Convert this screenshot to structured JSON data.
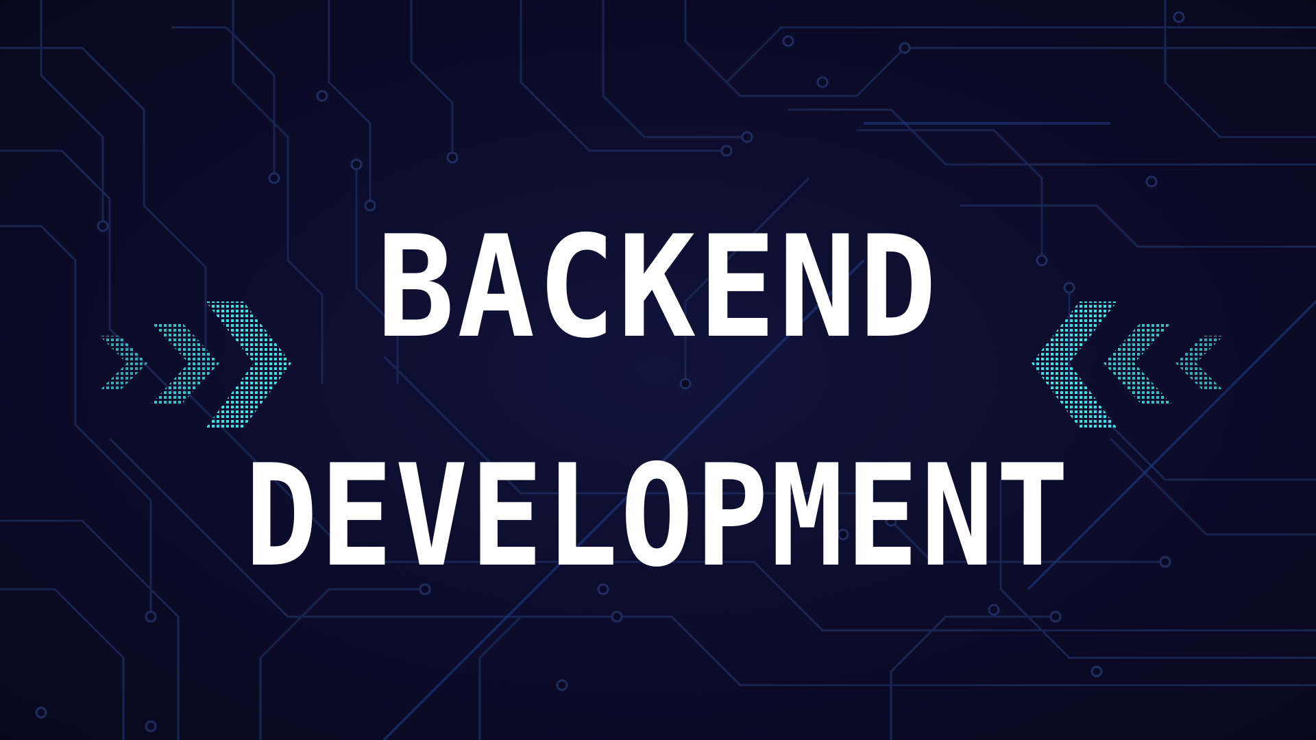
{
  "title": {
    "line1": "BACKEND",
    "line2": "DEVELOPMENT"
  },
  "decorations": {
    "left_chevrons": "chevron-right-icon",
    "right_chevrons": "chevron-left-icon",
    "background": "circuit-board-pattern"
  },
  "colors": {
    "background": "#0b0b26",
    "circuit_line": "#1c2a5a",
    "accent": "#36e3e8",
    "text": "#ffffff"
  }
}
